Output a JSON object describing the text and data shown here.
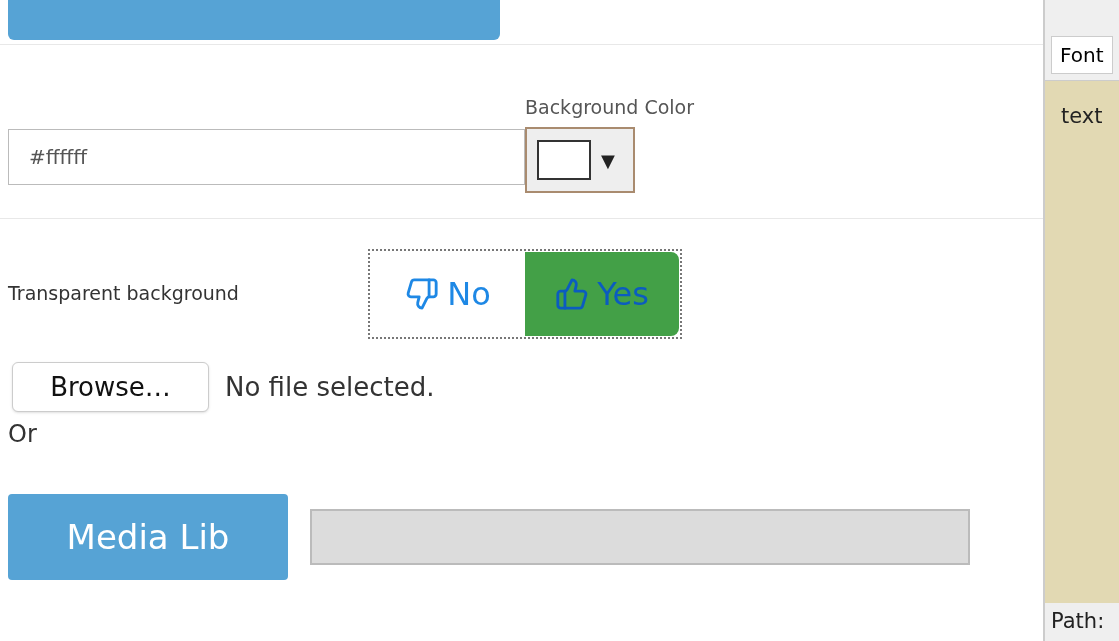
{
  "background_color": {
    "label": "Background Color",
    "value": "#ffffff",
    "caret": "▼"
  },
  "transparent": {
    "label": "Transparent background",
    "options": [
      {
        "kind": "no",
        "label": "No",
        "selected": false
      },
      {
        "kind": "yes",
        "label": "Yes",
        "selected": true
      }
    ]
  },
  "file": {
    "button": "Browse…",
    "status": "No file selected."
  },
  "or_label": "Or",
  "media_lib": {
    "button": "Media Lib"
  },
  "editor": {
    "font_select": "Font",
    "content": "text",
    "path_label": "Path:"
  }
}
